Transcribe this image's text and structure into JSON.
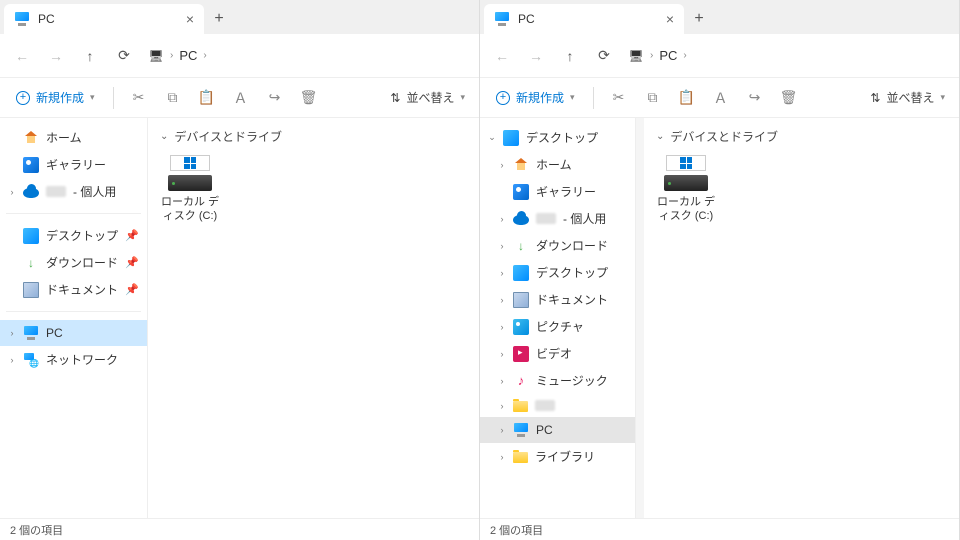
{
  "left": {
    "tab_title": "PC",
    "breadcrumb": [
      "PC"
    ],
    "new_label": "新規作成",
    "sort_label": "並べ替え",
    "sidebar": [
      {
        "type": "item",
        "icon": "home",
        "label": "ホーム",
        "chev": false
      },
      {
        "type": "item",
        "icon": "gallery",
        "label": "ギャラリー",
        "chev": false
      },
      {
        "type": "item",
        "icon": "onedrive",
        "label": " - 個人用",
        "chev": true,
        "blur": true
      },
      {
        "type": "sep"
      },
      {
        "type": "item",
        "icon": "desktop",
        "label": "デスクトップ",
        "chev": false,
        "pin": true
      },
      {
        "type": "item",
        "icon": "download",
        "label": "ダウンロード",
        "chev": false,
        "pin": true
      },
      {
        "type": "item",
        "icon": "document",
        "label": "ドキュメント",
        "chev": false,
        "pin": true
      },
      {
        "type": "sep"
      },
      {
        "type": "item",
        "icon": "pc",
        "label": "PC",
        "chev": true,
        "selected": true
      },
      {
        "type": "item",
        "icon": "network",
        "label": "ネットワーク",
        "chev": true
      }
    ],
    "group_label": "デバイスとドライブ",
    "drives": [
      {
        "name": "ローカル ディスク (C:)"
      }
    ],
    "status": "2 個の項目"
  },
  "right": {
    "tab_title": "PC",
    "breadcrumb": [
      "PC"
    ],
    "new_label": "新規作成",
    "sort_label": "並べ替え",
    "sidebar": [
      {
        "type": "item",
        "icon": "desktop",
        "label": "デスクトップ",
        "chev": "down",
        "indent": 0
      },
      {
        "type": "item",
        "icon": "home",
        "label": "ホーム",
        "chev": true,
        "indent": 1
      },
      {
        "type": "item",
        "icon": "gallery",
        "label": "ギャラリー",
        "chev": false,
        "indent": 1
      },
      {
        "type": "item",
        "icon": "onedrive",
        "label": " - 個人用",
        "chev": true,
        "indent": 1,
        "blur": true
      },
      {
        "type": "item",
        "icon": "download",
        "label": "ダウンロード",
        "chev": true,
        "indent": 1
      },
      {
        "type": "item",
        "icon": "desktop",
        "label": "デスクトップ",
        "chev": true,
        "indent": 1
      },
      {
        "type": "item",
        "icon": "document",
        "label": "ドキュメント",
        "chev": true,
        "indent": 1
      },
      {
        "type": "item",
        "icon": "pictures",
        "label": "ピクチャ",
        "chev": true,
        "indent": 1
      },
      {
        "type": "item",
        "icon": "video",
        "label": "ビデオ",
        "chev": true,
        "indent": 1
      },
      {
        "type": "item",
        "icon": "music",
        "label": "ミュージック",
        "chev": true,
        "indent": 1
      },
      {
        "type": "item",
        "icon": "folder",
        "label": "",
        "chev": true,
        "indent": 1,
        "blur": true
      },
      {
        "type": "item",
        "icon": "pc",
        "label": "PC",
        "chev": true,
        "indent": 1,
        "selected2": true
      },
      {
        "type": "item",
        "icon": "folder",
        "label": "ライブラリ",
        "chev": true,
        "indent": 1
      }
    ],
    "group_label": "デバイスとドライブ",
    "drives": [
      {
        "name": "ローカル ディスク (C:)"
      }
    ],
    "status": "2 個の項目"
  }
}
